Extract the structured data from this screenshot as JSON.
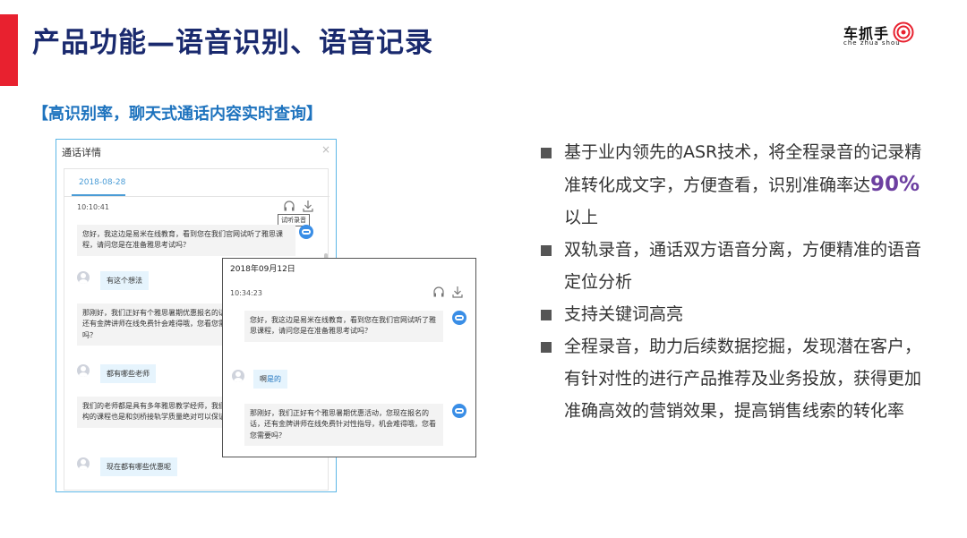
{
  "title": "产品功能—语音识别、语音记录",
  "logo": {
    "text": "车抓手",
    "sub": "che zhua shou"
  },
  "subheading": "【高识别率，聊天式通话内容实时查询】",
  "dialog": {
    "title": "通话详情",
    "close": "×",
    "date_tab": "2018-08-28",
    "time": "10:10:41",
    "tooltip": "试听录音",
    "messages": [
      {
        "side": "agent",
        "text": "您好，我这边是易米在线教育，看到您在我们官网试听了雅思课程，请问您是在准备雅思考试吗？"
      },
      {
        "side": "customer",
        "text": "有这个想法"
      },
      {
        "side": "agent",
        "text": "那刚好，我们正好有个雅思暑期优惠报名的话，还有金牌讲师在线免费针会难得哦，您看您需要吗？"
      },
      {
        "side": "customer",
        "text": "都有哪些老师"
      },
      {
        "side": "agent",
        "text": "我们的老师都是具有多年雅思教学经师，我们机构的课程也是和剑桥接轨学质量绝对可以保证"
      },
      {
        "side": "customer",
        "text": "现在都有哪些优惠呢"
      }
    ]
  },
  "overlay": {
    "date": "2018年09月12日",
    "time": "10:34:23",
    "messages": [
      {
        "side": "agent",
        "text": "您好，我这边是易米在线教育，看到您在我们官网试听了雅思课程，请问您是在准备雅思考试吗？"
      },
      {
        "side": "customer",
        "text_plain": "啊",
        "text_highlight": "是的"
      },
      {
        "side": "agent",
        "text": "那刚好，我们正好有个雅思暑期优惠活动，您现在报名的话，还有金牌讲师在线免费针对性指导，机会难得哦，您看您需要吗？"
      }
    ]
  },
  "bullets": {
    "b1_pre": "基于业内领先的ASR技术，将全程录音的记录精准转化成文字，方便查看，识别准确率达",
    "b1_highlight": "90%",
    "b1_post": "以上",
    "b2": "双轨录音，通话双方语音分离，方便精准的语音定位分析",
    "b3": "支持关键词高亮",
    "b4": "全程录音，助力后续数据挖掘，发现潜在客户，有针对性的进行产品推荐及业务投放，获得更加准确高效的营销效果，提高销售线索的转化率"
  },
  "colors": {
    "accent": "#e8212f",
    "title": "#1a2a6e",
    "link": "#1e73be",
    "highlight": "#6c3fa0"
  },
  "icons": [
    "headphone-icon",
    "download-icon",
    "user-avatar-icon",
    "agent-bot-icon"
  ]
}
